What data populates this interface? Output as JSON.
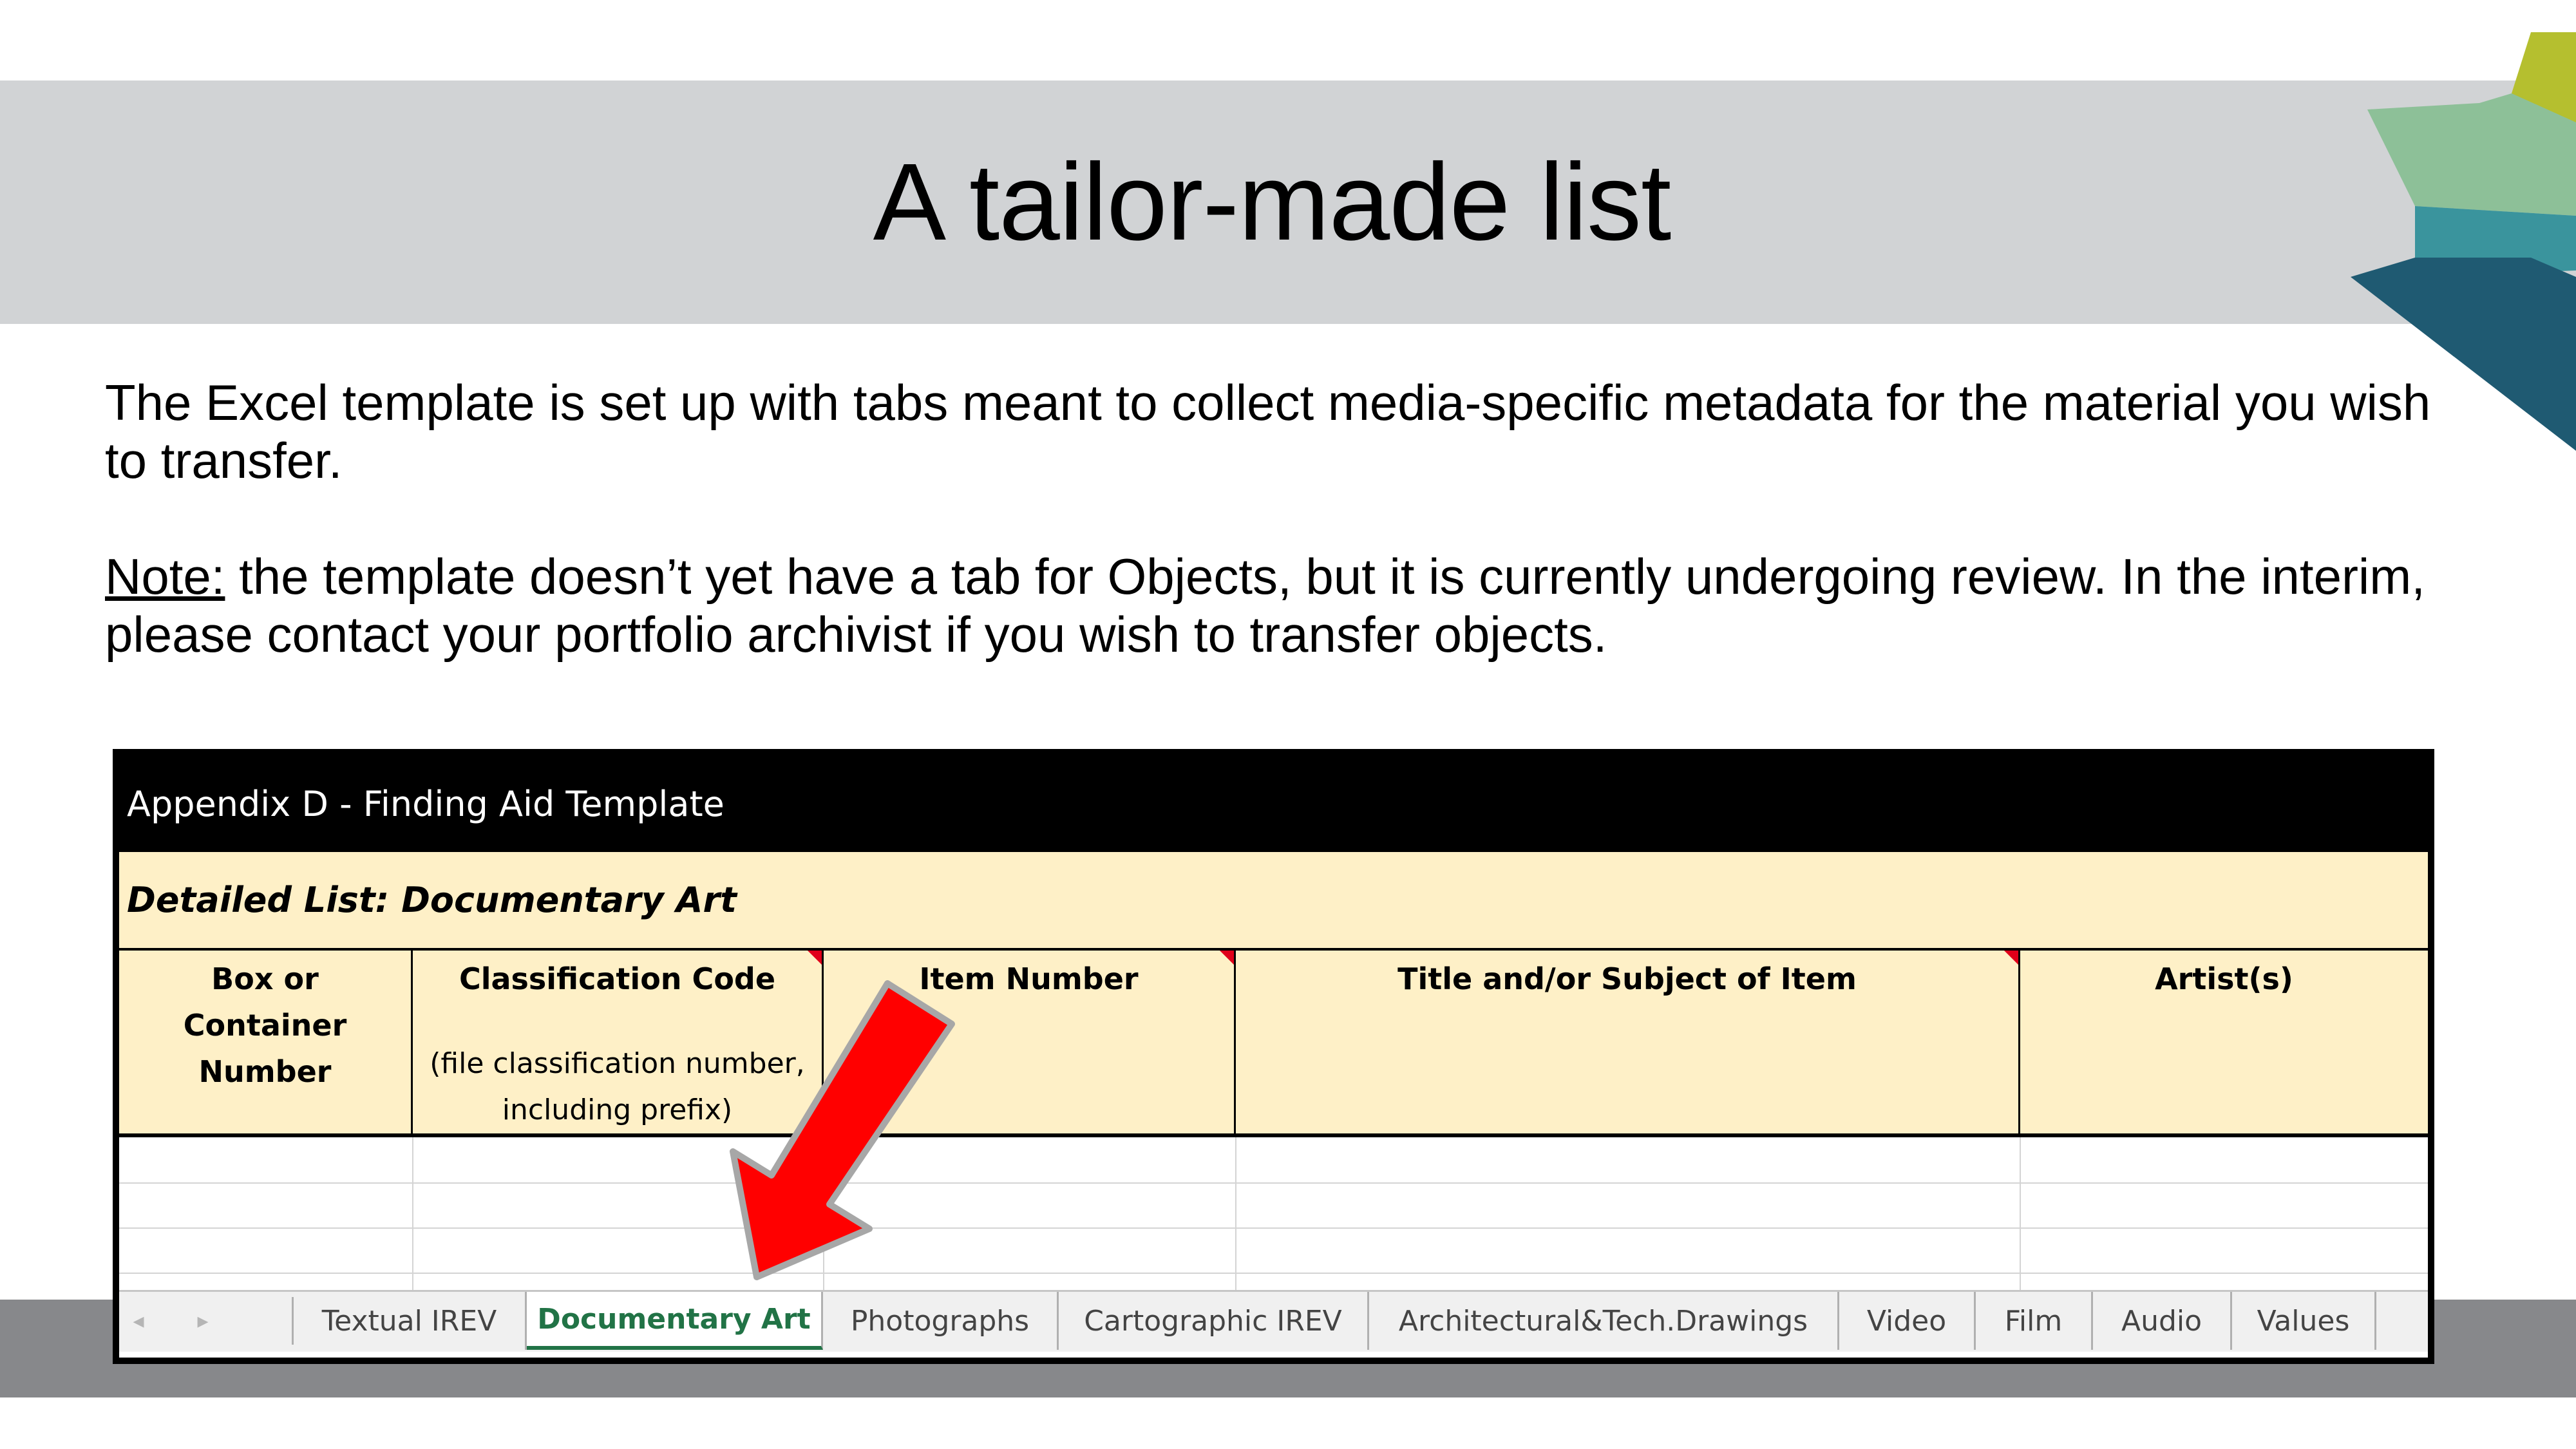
{
  "slide": {
    "title": "A tailor-made list",
    "paragraph1": "The Excel template is set up with tabs meant to collect media-specific metadata for the material you wish to transfer.",
    "note_label": "Note:",
    "note_text": " the template doesn’t yet have a tab for Objects, but it is currently undergoing review. In the interim, please contact your portfolio archivist if you wish to transfer objects."
  },
  "excel": {
    "title": "Appendix D - Finding Aid Template",
    "subtitle": "Detailed List: Documentary Art",
    "columns": [
      {
        "label": "Box or Container Number",
        "sub": ""
      },
      {
        "label": "Classification Code",
        "sub": "(file classification number, including prefix)"
      },
      {
        "label": "Item Number",
        "sub": ""
      },
      {
        "label": "Title and/or Subject of Item",
        "sub": ""
      },
      {
        "label": "Artist(s)",
        "sub": ""
      }
    ],
    "tabs": [
      "Textual IREV",
      "Documentary Art",
      "Photographs",
      "Cartographic IREV",
      "Architectural&Tech.Drawings",
      "Video",
      "Film",
      "Audio",
      "Values"
    ],
    "active_tab": "Documentary Art",
    "nav_prev": "◂",
    "nav_next": "▸"
  },
  "colors": {
    "title_band": "#d1d3d5",
    "header_fill": "#fef0c7",
    "active_tab": "#217346",
    "arrow": "#ff0000",
    "bottom_band": "#87888b"
  },
  "icons": [
    "red-arrow-icon",
    "corner-comment-marker-icon",
    "tab-scroll-left-icon",
    "tab-scroll-right-icon"
  ]
}
